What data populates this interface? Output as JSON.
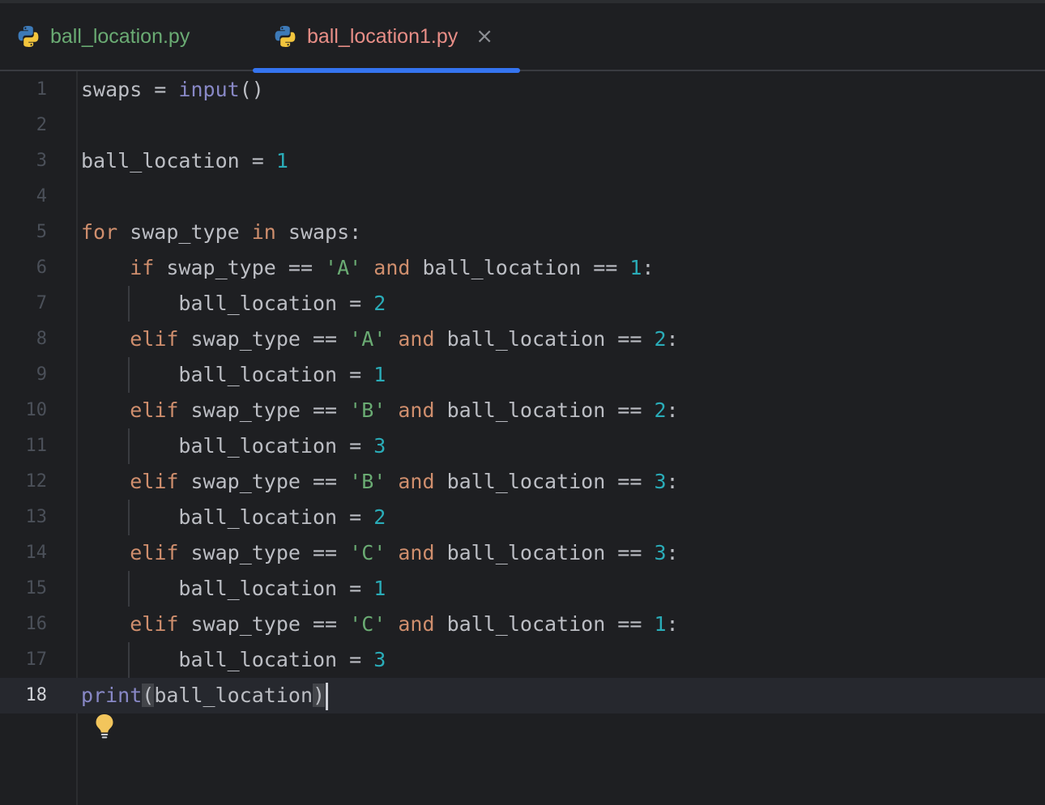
{
  "tabs": [
    {
      "label": "ball_location.py",
      "icon": "python-icon",
      "active": false
    },
    {
      "label": "ball_location1.py",
      "icon": "python-icon",
      "active": true,
      "close_glyph": "×"
    }
  ],
  "colors": {
    "background": "#1e1f22",
    "keyword": "#cf8e6d",
    "builtin": "#8888c6",
    "number": "#2aacb8",
    "string": "#6aab73",
    "active_tab_underline": "#3574f0",
    "modified_tab_label": "#e88e87",
    "inactive_tab_label": "#6aab73"
  },
  "editor": {
    "current_line": 18,
    "intention_icon": "lightbulb-icon",
    "intention_line": 17,
    "lines": [
      {
        "num": "1",
        "tokens": [
          [
            "p",
            "swaps = "
          ],
          [
            "b",
            "input"
          ],
          [
            "p",
            "()"
          ]
        ]
      },
      {
        "num": "2",
        "tokens": []
      },
      {
        "num": "3",
        "tokens": [
          [
            "p",
            "ball_location = "
          ],
          [
            "n",
            "1"
          ]
        ]
      },
      {
        "num": "4",
        "tokens": []
      },
      {
        "num": "5",
        "tokens": [
          [
            "k",
            "for"
          ],
          [
            "p",
            " swap_type "
          ],
          [
            "k",
            "in"
          ],
          [
            "p",
            " swaps:"
          ]
        ]
      },
      {
        "num": "6",
        "tokens": [
          [
            "p",
            "    "
          ],
          [
            "k",
            "if"
          ],
          [
            "p",
            " swap_type == "
          ],
          [
            "s",
            "'A'"
          ],
          [
            "p",
            " "
          ],
          [
            "k",
            "and"
          ],
          [
            "p",
            " ball_location == "
          ],
          [
            "n",
            "1"
          ],
          [
            "p",
            ":"
          ]
        ]
      },
      {
        "num": "7",
        "tokens": [
          [
            "p",
            "        ball_location = "
          ],
          [
            "n",
            "2"
          ]
        ]
      },
      {
        "num": "8",
        "tokens": [
          [
            "p",
            "    "
          ],
          [
            "k",
            "elif"
          ],
          [
            "p",
            " swap_type == "
          ],
          [
            "s",
            "'A'"
          ],
          [
            "p",
            " "
          ],
          [
            "k",
            "and"
          ],
          [
            "p",
            " ball_location == "
          ],
          [
            "n",
            "2"
          ],
          [
            "p",
            ":"
          ]
        ]
      },
      {
        "num": "9",
        "tokens": [
          [
            "p",
            "        ball_location = "
          ],
          [
            "n",
            "1"
          ]
        ]
      },
      {
        "num": "10",
        "tokens": [
          [
            "p",
            "    "
          ],
          [
            "k",
            "elif"
          ],
          [
            "p",
            " swap_type == "
          ],
          [
            "s",
            "'B'"
          ],
          [
            "p",
            " "
          ],
          [
            "k",
            "and"
          ],
          [
            "p",
            " ball_location == "
          ],
          [
            "n",
            "2"
          ],
          [
            "p",
            ":"
          ]
        ]
      },
      {
        "num": "11",
        "tokens": [
          [
            "p",
            "        ball_location = "
          ],
          [
            "n",
            "3"
          ]
        ]
      },
      {
        "num": "12",
        "tokens": [
          [
            "p",
            "    "
          ],
          [
            "k",
            "elif"
          ],
          [
            "p",
            " swap_type == "
          ],
          [
            "s",
            "'B'"
          ],
          [
            "p",
            " "
          ],
          [
            "k",
            "and"
          ],
          [
            "p",
            " ball_location == "
          ],
          [
            "n",
            "3"
          ],
          [
            "p",
            ":"
          ]
        ]
      },
      {
        "num": "13",
        "tokens": [
          [
            "p",
            "        ball_location = "
          ],
          [
            "n",
            "2"
          ]
        ]
      },
      {
        "num": "14",
        "tokens": [
          [
            "p",
            "    "
          ],
          [
            "k",
            "elif"
          ],
          [
            "p",
            " swap_type == "
          ],
          [
            "s",
            "'C'"
          ],
          [
            "p",
            " "
          ],
          [
            "k",
            "and"
          ],
          [
            "p",
            " ball_location == "
          ],
          [
            "n",
            "3"
          ],
          [
            "p",
            ":"
          ]
        ]
      },
      {
        "num": "15",
        "tokens": [
          [
            "p",
            "        ball_location = "
          ],
          [
            "n",
            "1"
          ]
        ]
      },
      {
        "num": "16",
        "tokens": [
          [
            "p",
            "    "
          ],
          [
            "k",
            "elif"
          ],
          [
            "p",
            " swap_type == "
          ],
          [
            "s",
            "'C'"
          ],
          [
            "p",
            " "
          ],
          [
            "k",
            "and"
          ],
          [
            "p",
            " ball_location == "
          ],
          [
            "n",
            "1"
          ],
          [
            "p",
            ":"
          ]
        ]
      },
      {
        "num": "17",
        "tokens": [
          [
            "p",
            "        ball_location = "
          ],
          [
            "n",
            "3"
          ]
        ]
      },
      {
        "num": "18",
        "tokens": [
          [
            "b",
            "print"
          ],
          [
            "h",
            "("
          ],
          [
            "p",
            "ball_location"
          ],
          [
            "h",
            ")"
          ]
        ]
      }
    ]
  }
}
